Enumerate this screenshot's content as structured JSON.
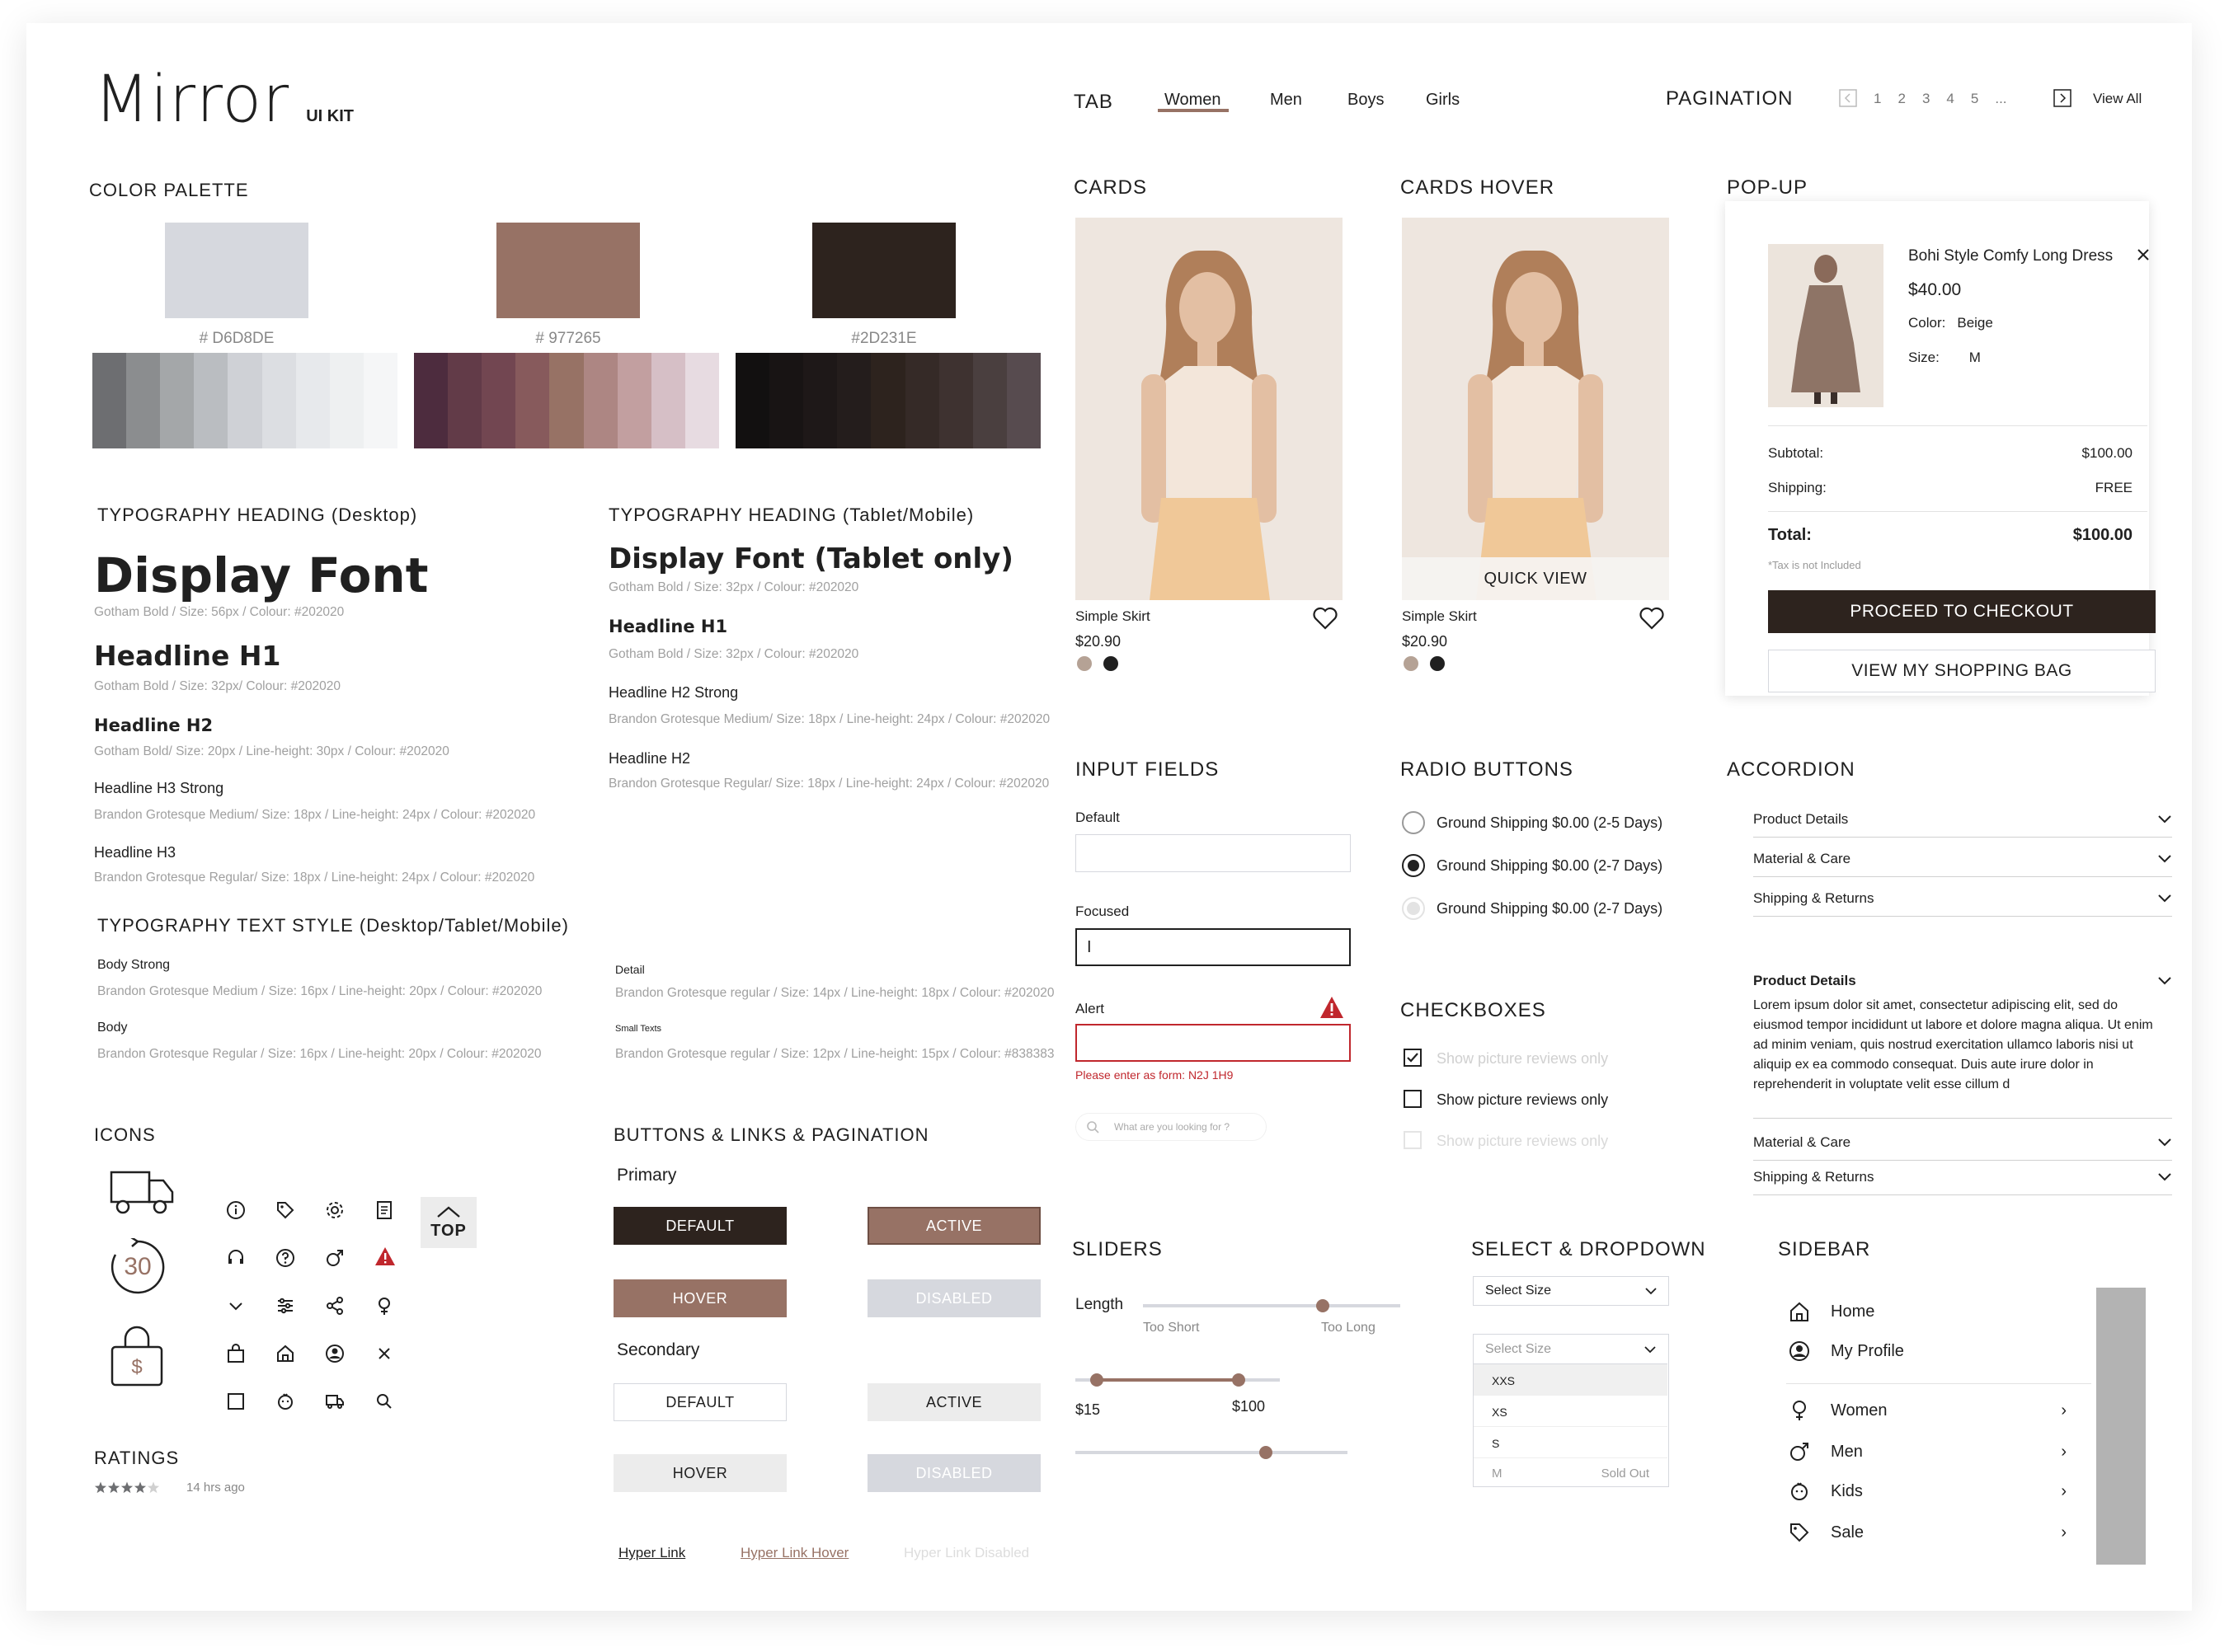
{
  "brand": {
    "logo": "Mirror",
    "kit": "UI KIT"
  },
  "tab": {
    "title": "TAB",
    "items": [
      "Women",
      "Men",
      "Boys",
      "Girls"
    ]
  },
  "pagination": {
    "title": "PAGINATION",
    "pages": [
      "1",
      "2",
      "3",
      "4",
      "5",
      "..."
    ],
    "view_all": "View All"
  },
  "palette": {
    "title": "COLOR PALETTE",
    "swatches": [
      {
        "hex": "#D6D8DE",
        "label": "# D6D8DE",
        "tones": [
          "#6d6e71",
          "#8b8d8f",
          "#a4a7a9",
          "#babdc1",
          "#cfd1d6",
          "#dcdee2",
          "#e7e9ec",
          "#eef0f1",
          "#f5f6f7"
        ]
      },
      {
        "hex": "#977265",
        "label": "# 977265",
        "tones": [
          "#4d2c3e",
          "#623b48",
          "#724651",
          "#875a5c",
          "#977265",
          "#ad8683",
          "#c29fa0",
          "#d6bfc6",
          "#e7dbe1"
        ]
      },
      {
        "hex": "#2D231E",
        "label": "#2D231E",
        "tones": [
          "#121010",
          "#181414",
          "#1e1818",
          "#241d1c",
          "#2d231e",
          "#352a27",
          "#3e3230",
          "#4a3f3f",
          "#574b4f"
        ]
      }
    ]
  },
  "typo_desktop": {
    "title": "TYPOGRAPHY HEADING (Desktop)",
    "display": "Display Font",
    "display_spec": "Gotham Bold / Size: 56px / Colour: #202020",
    "h1": "Headline H1",
    "h1_spec": "Gotham Bold / Size: 32px/ Colour: #202020",
    "h2": "Headline H2",
    "h2_spec": "Gotham Bold/ Size: 20px / Line-height: 30px / Colour: #202020",
    "h3s": "Headline H3 Strong",
    "h3s_spec": "Brandon Grotesque Medium/ Size: 18px / Line-height: 24px / Colour: #202020",
    "h3": "Headline H3",
    "h3_spec": "Brandon Grotesque Regular/ Size: 18px / Line-height: 24px / Colour: #202020"
  },
  "typo_tablet": {
    "title": "TYPOGRAPHY HEADING (Tablet/Mobile)",
    "display": "Display Font (Tablet only)",
    "display_spec": "Gotham Bold / Size: 32px / Colour: #202020",
    "h1": "Headline H1",
    "h1_spec": "Gotham Bold / Size: 32px / Colour: #202020",
    "h2s": "Headline H2 Strong",
    "h2s_spec": "Brandon Grotesque Medium/ Size: 18px / Line-height: 24px / Colour: #202020",
    "h2": "Headline H2",
    "h2_spec": "Brandon Grotesque Regular/ Size: 18px / Line-height: 24px / Colour: #202020"
  },
  "typo_text": {
    "title": "TYPOGRAPHY TEXT STYLE (Desktop/Tablet/Mobile)",
    "body_strong": "Body  Strong",
    "body_strong_spec": "Brandon Grotesque Medium / Size: 16px / Line-height: 20px / Colour: #202020",
    "body": "Body",
    "body_spec": "Brandon Grotesque Regular / Size: 16px / Line-height: 20px / Colour: #202020",
    "detail": "Detail",
    "detail_spec": "Brandon Grotesque regular / Size: 14px / Line-height: 18px / Colour: #202020",
    "small": "Small Texts",
    "small_spec": "Brandon Grotesque regular / Size: 12px / Line-height: 15px / Colour: #838383"
  },
  "icons": {
    "title": "ICONS",
    "days": "30",
    "top": "TOP"
  },
  "ratings": {
    "title": "RATINGS",
    "time": "14 hrs ago",
    "stars": 4,
    "max_stars": 5
  },
  "buttons": {
    "title": "BUTTONS & LINKS & PAGINATION",
    "primary": "Primary",
    "secondary": "Secondary",
    "default": "DEFAULT",
    "active": "ACTIVE",
    "hover": "HOVER",
    "disabled": "DISABLED",
    "link": "Hyper Link",
    "link_hover": "Hyper Link Hover",
    "link_disabled": "Hyper Link Disabled"
  },
  "cards": {
    "title": "CARDS",
    "hover_title": "CARDS HOVER",
    "name": "Simple Skirt",
    "price": "$20.90",
    "quick_view": "QUICK VIEW",
    "colors": [
      "#b5a295",
      "#202020"
    ]
  },
  "popup": {
    "title": "POP-UP",
    "product": "Bohi Style Comfy Long Dress",
    "price": "$40.00",
    "color_label": "Color:",
    "color": "Beige",
    "size_label": "Size:",
    "size": "M",
    "subtotal_label": "Subtotal:",
    "subtotal": "$100.00",
    "shipping_label": "Shipping:",
    "shipping": "FREE",
    "total_label": "Total:",
    "total": "$100.00",
    "tax_note": "*Tax is not Included",
    "checkout": "PROCEED TO CHECKOUT",
    "view_bag": "VIEW MY SHOPPING BAG"
  },
  "inputs": {
    "title": "INPUT FIELDS",
    "default": "Default",
    "focused": "Focused",
    "focused_value": "I",
    "alert": "Alert",
    "alert_msg": "Please enter as form: N2J 1H9",
    "search_placeholder": "What are you looking for ?"
  },
  "radios": {
    "title": "RADIO BUTTONS",
    "options": [
      "Ground Shipping $0.00 (2-5 Days)",
      "Ground Shipping $0.00 (2-7 Days)",
      "Ground Shipping $0.00 (2-7 Days)"
    ]
  },
  "checkboxes": {
    "title": "CHECKBOXES",
    "label": "Show picture reviews only"
  },
  "accordion": {
    "title": "ACCORDION",
    "rows": [
      "Product Details",
      "Material & Care",
      "Shipping & Returns"
    ],
    "open_title": "Product Details",
    "open_body": "Lorem ipsum dolor sit amet, consectetur adipiscing elit, sed do eiusmod tempor incididunt ut labore et dolore magna aliqua. Ut enim ad minim veniam, quis nostrud exercitation ullamco laboris nisi ut aliquip ex ea commodo consequat. Duis aute irure dolor in reprehenderit in voluptate velit esse cillum d",
    "rows_after": [
      "Material & Care",
      "Shipping & Returns"
    ]
  },
  "sliders": {
    "title": "SLIDERS",
    "length": "Length",
    "too_short": "Too Short",
    "too_long": "Too Long",
    "min": "$15",
    "max": "$100",
    "level_length": 0.7,
    "level_single": 0.7
  },
  "select": {
    "title": "SELECT & DROPDOWN",
    "placeholder": "Select Size",
    "options": [
      "XXS",
      "XS",
      "S",
      "M"
    ],
    "sold_out": "Sold Out"
  },
  "sidebar": {
    "title": "SIDEBAR",
    "items": [
      "Home",
      "My Profile"
    ],
    "cats": [
      "Women",
      "Men",
      "Kids",
      "Sale"
    ]
  }
}
